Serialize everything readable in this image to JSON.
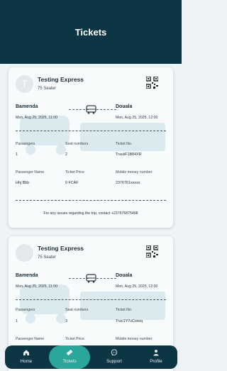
{
  "header": {
    "title": "Tickets"
  },
  "tickets": [
    {
      "avatar_letter": "T",
      "company": "Testing Express",
      "seater": "75 Seater",
      "from_city": "Bamenda",
      "to_city": "Douala",
      "from_time": "Mon, Aug 25, 2025, 11:00",
      "to_time": "Mon, Aug 25, 2025, 12:00",
      "passengers_label": "Passengers",
      "passengers": "1",
      "seat_label": "Seat numbers",
      "seat": "2",
      "ticket_no_label": "Ticket No.",
      "ticket_no": "TravkF1B84XR",
      "passenger_name_label": "Passenger Name",
      "passenger_name": "Hhj Bbb",
      "price_label": "Ticket Price",
      "price": "9 FCAF",
      "mobile_label": "Mobile money number",
      "mobile": "2376761xxxxx",
      "support_note": "For any issues regarding the trip, contact +237676875498"
    },
    {
      "avatar_letter": "",
      "company": "Testing Express",
      "seater": "75 Seater",
      "from_city": "Bamenda",
      "to_city": "Douala",
      "from_time": "Mon, Aug 25, 2025, 11:00",
      "to_time": "Mon, Aug 25, 2025, 12:00",
      "passengers_label": "Passengers",
      "passengers": "1",
      "seat_label": "Seat numbers",
      "seat": "3",
      "ticket_no_label": "Ticket No.",
      "ticket_no": "Trav1Y7uCwwq",
      "passenger_name_label": "Passenger Name",
      "price_label": "Ticket Price",
      "mobile_label": "Mobile money number"
    }
  ],
  "nav": {
    "home": "Home",
    "tickets": "Tickets",
    "support": "Support",
    "profile": "Profile"
  },
  "colors": {
    "header_bg": "#0c3643",
    "accent": "#2aa69a"
  },
  "icons": [
    "qr-code-icon",
    "bus-icon",
    "home-icon",
    "ticket-icon",
    "chat-icon",
    "person-icon"
  ]
}
